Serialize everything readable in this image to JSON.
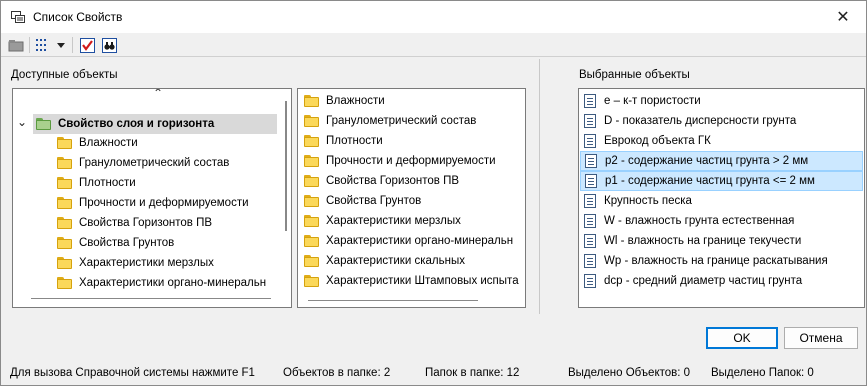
{
  "window": {
    "title": "Список Свойств",
    "close_glyph": "✕"
  },
  "toolbar": {
    "items": [
      {
        "icon": "back-folder-icon"
      },
      {
        "icon": "list-view-icon"
      },
      {
        "icon": "dropdown-arrow-icon"
      },
      {
        "icon": "checkmark-icon"
      },
      {
        "icon": "find-icon"
      }
    ]
  },
  "left": {
    "label": "Доступные объекты",
    "scroll_up_glyph": "⌃",
    "tree_toggle": "⌄",
    "tree_root": "Свойство слоя и горизонта",
    "tree_children": [
      "Влажности",
      "Гранулометрический состав",
      "Плотности",
      "Прочности и деформируемости",
      "Свойства Горизонтов ПВ",
      "Свойства Грунтов",
      "Характеристики мерзлых",
      "Характеристики органо-минеральн"
    ],
    "folder_list": [
      "Влажности",
      "Гранулометрический состав",
      "Плотности",
      "Прочности и деформируемости",
      "Свойства Горизонтов ПВ",
      "Свойства Грунтов",
      "Характеристики мерзлых",
      "Характеристики органо-минеральн",
      "Характеристики скальных",
      "Характеристики Штамповых испыта"
    ]
  },
  "middle": {
    "add_glyph": "➜",
    "remove_glyph": "✖",
    "up_glyph": "⬆",
    "down_glyph": "⬇"
  },
  "right": {
    "label": "Выбранные объекты",
    "items": [
      "e – к-т пористости",
      "D - показатель дисперсности грунта",
      "Еврокод объекта ГК",
      "p2 - содержание частиц грунта > 2 мм",
      "p1 - содержание частиц грунта <= 2 мм",
      "Крупность песка",
      "W - влажность грунта естественная",
      "Wl - влажность на границе текучести",
      "Wp - влажность на границе раскатывания",
      "dcp - средний диаметр частиц грунта"
    ],
    "selected_indices": [
      3,
      4
    ]
  },
  "buttons": {
    "ok": "OK",
    "cancel": "Отмена"
  },
  "status": {
    "help": "Для вызова Справочной системы нажмите F1",
    "objects_in_folder": "Объектов в папке: 2",
    "folders_in_folder": "Папок в папке: 12",
    "selected_objects": "Выделено Объектов: 0",
    "selected_folders": "Выделено Папок: 0"
  },
  "colors": {
    "selection_bg": "#cce8ff",
    "selection_border": "#99d1ff",
    "remove_red": "#d11a1a",
    "arrow_green": "#2e7d32",
    "default_button_border": "#0078d7"
  }
}
